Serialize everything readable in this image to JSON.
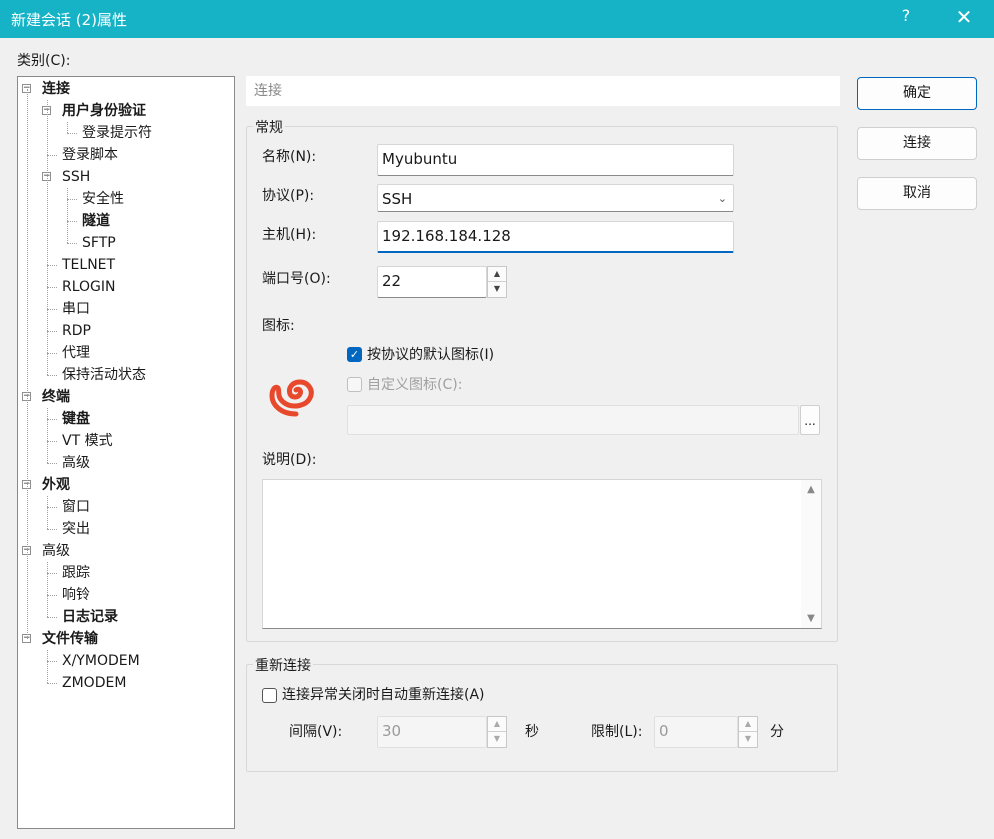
{
  "window": {
    "title": "新建会话 (2)属性",
    "help": "?",
    "close": "✕"
  },
  "category_label": "类别(C):",
  "tree": [
    {
      "label": "连接",
      "bold": true,
      "level": 0,
      "expander": "−"
    },
    {
      "label": "用户身份验证",
      "bold": true,
      "level": 1,
      "expander": "−"
    },
    {
      "label": "登录提示符",
      "bold": false,
      "level": 2
    },
    {
      "label": "登录脚本",
      "bold": false,
      "level": 1
    },
    {
      "label": "SSH",
      "bold": false,
      "level": 1,
      "expander": "−"
    },
    {
      "label": "安全性",
      "bold": false,
      "level": 2
    },
    {
      "label": "隧道",
      "bold": true,
      "level": 2
    },
    {
      "label": "SFTP",
      "bold": false,
      "level": 2
    },
    {
      "label": "TELNET",
      "bold": false,
      "level": 1
    },
    {
      "label": "RLOGIN",
      "bold": false,
      "level": 1
    },
    {
      "label": "串口",
      "bold": false,
      "level": 1
    },
    {
      "label": "RDP",
      "bold": false,
      "level": 1
    },
    {
      "label": "代理",
      "bold": false,
      "level": 1
    },
    {
      "label": "保持活动状态",
      "bold": false,
      "level": 1
    },
    {
      "label": "终端",
      "bold": true,
      "level": 0,
      "expander": "−"
    },
    {
      "label": "键盘",
      "bold": true,
      "level": 1
    },
    {
      "label": "VT 模式",
      "bold": false,
      "level": 1
    },
    {
      "label": "高级",
      "bold": false,
      "level": 1
    },
    {
      "label": "外观",
      "bold": true,
      "level": 0,
      "expander": "−"
    },
    {
      "label": "窗口",
      "bold": false,
      "level": 1
    },
    {
      "label": "突出",
      "bold": false,
      "level": 1
    },
    {
      "label": "高级",
      "bold": false,
      "level": 0,
      "expander": "−"
    },
    {
      "label": "跟踪",
      "bold": false,
      "level": 1
    },
    {
      "label": "响铃",
      "bold": false,
      "level": 1
    },
    {
      "label": "日志记录",
      "bold": true,
      "level": 1
    },
    {
      "label": "文件传输",
      "bold": true,
      "level": 0,
      "expander": "−"
    },
    {
      "label": "X/YMODEM",
      "bold": false,
      "level": 1
    },
    {
      "label": "ZMODEM",
      "bold": false,
      "level": 1
    }
  ],
  "header": "连接",
  "general": {
    "title": "常规",
    "name_label": "名称(N):",
    "name_value": "Myubuntu",
    "protocol_label": "协议(P):",
    "protocol_value": "SSH",
    "host_label": "主机(H):",
    "host_value": "192.168.184.128",
    "port_label": "端口号(O):",
    "port_value": "22",
    "icon_label": "图标:",
    "default_icon_label": "按协议的默认图标(I)",
    "default_icon_checked": true,
    "custom_icon_label": "自定义图标(C):",
    "browse_label": "...",
    "desc_label": "说明(D):"
  },
  "reconnect": {
    "title": "重新连接",
    "auto_label": "连接异常关闭时自动重新连接(A)",
    "interval_label": "间隔(V):",
    "interval_value": "30",
    "interval_unit": "秒",
    "limit_label": "限制(L):",
    "limit_value": "0",
    "limit_unit": "分"
  },
  "buttons": {
    "ok": "确定",
    "connect": "连接",
    "cancel": "取消"
  },
  "colors": {
    "titlebar": "#16b3c7",
    "accent": "#0067c0",
    "icon": "#e8482c"
  }
}
